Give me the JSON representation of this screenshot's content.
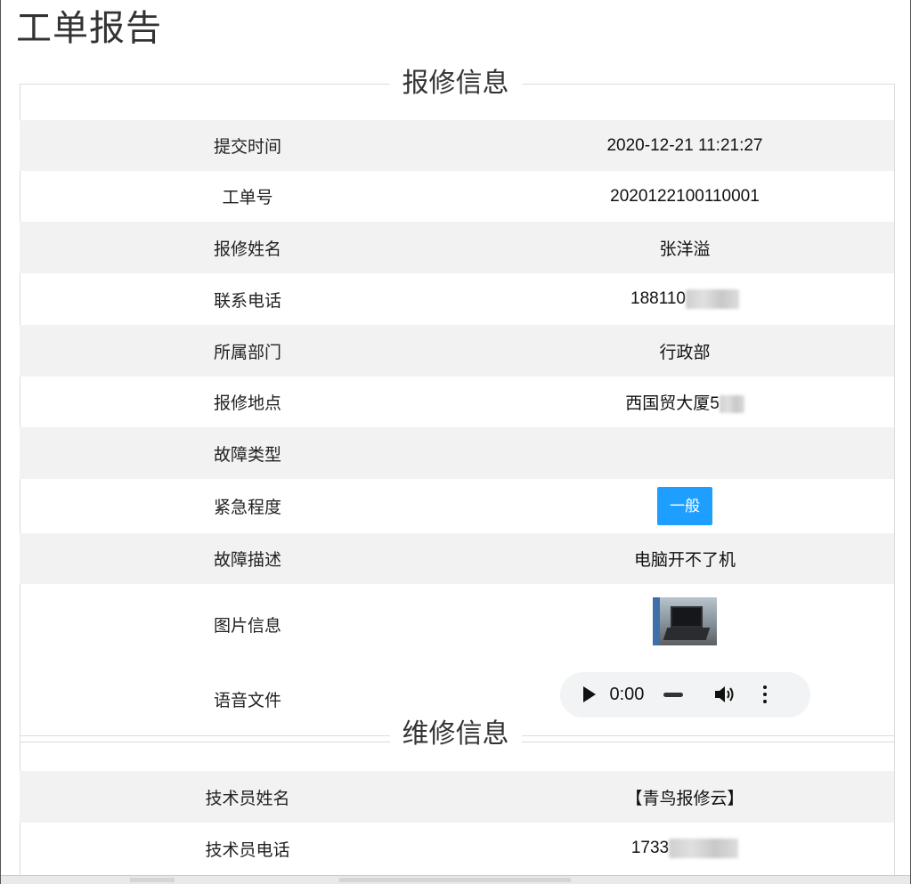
{
  "page": {
    "title": "工单报告"
  },
  "repair_section": {
    "legend": "报修信息",
    "rows": [
      {
        "label": "提交时间",
        "value": "2020-12-21 11:21:27"
      },
      {
        "label": "工单号",
        "value": "202012210011000​1"
      },
      {
        "label": "报修姓名",
        "value": "张洋溢"
      },
      {
        "label": "联系电话",
        "value": "188110"
      },
      {
        "label": "所属部门",
        "value": "行政部"
      },
      {
        "label": "报修地点",
        "value": "西国贸大厦5"
      },
      {
        "label": "故障类型",
        "value": ""
      },
      {
        "label": "紧急程度",
        "value": "一般"
      },
      {
        "label": "故障描述",
        "value": "电脑开不了机"
      },
      {
        "label": "图片信息",
        "value": ""
      },
      {
        "label": "语音文件",
        "value": ""
      }
    ],
    "audio": {
      "time": "0:00"
    }
  },
  "maintenance_section": {
    "legend": "维修信息",
    "rows": [
      {
        "label": "技术员姓名",
        "value": "【青鸟报修云】"
      },
      {
        "label": "技术员电话",
        "value": "1733"
      }
    ]
  },
  "icons": {
    "play": "play-icon",
    "volume": "volume-icon",
    "more": "more-vertical-icon",
    "photo": "laptop-photo"
  },
  "colors": {
    "badge": "#1e9fff",
    "row_gray": "#f2f2f2",
    "audio_bg": "#f1f3f4"
  }
}
